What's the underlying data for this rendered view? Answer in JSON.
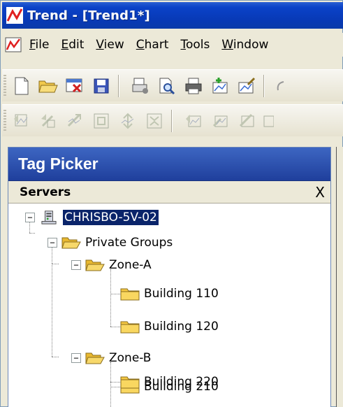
{
  "window": {
    "title": "Trend - [Trend1*]"
  },
  "menu": {
    "items": [
      {
        "label": "File",
        "ul": "F",
        "rest": "ile"
      },
      {
        "label": "Edit",
        "ul": "E",
        "rest": "dit"
      },
      {
        "label": "View",
        "ul": "V",
        "rest": "iew"
      },
      {
        "label": "Chart",
        "ul": "C",
        "rest": "hart"
      },
      {
        "label": "Tools",
        "ul": "T",
        "rest": "ools"
      },
      {
        "label": "Window",
        "ul": "W",
        "rest": "indow"
      }
    ]
  },
  "toolbar": {
    "row1_icons": [
      "new-icon",
      "open-icon",
      "close-file-icon",
      "save-icon",
      "print-setup-icon",
      "print-preview-icon",
      "print-icon",
      "add-tag-icon",
      "edit-tag-icon",
      "undo-icon"
    ],
    "row2_icons": [
      "pan-left-icon",
      "pan-back-icon",
      "pan-diagonal-icon",
      "zoom-fit-icon",
      "zoom-in-icon",
      "zoom-out-icon",
      "move-left-icon",
      "move-back-icon",
      "move-diagonal-icon",
      "zoom-box-icon"
    ]
  },
  "panel": {
    "title": "Tag Picker",
    "servers_label": "Servers",
    "close_symbol": "X"
  },
  "tree": {
    "server": "CHRISBO-5V-02",
    "private_groups": "Private Groups",
    "zone_a": "Zone-A",
    "building_110": "Building 110",
    "building_120": "Building 120",
    "zone_b": "Zone-B",
    "building_210": "Building 210",
    "building_220": "Building 220",
    "expanded_symbol": "−"
  },
  "colors": {
    "title_bar": "#0a42c8",
    "panel_header": "#2a4fb0",
    "selection": "#0a246a",
    "folder": "#f5c842"
  }
}
